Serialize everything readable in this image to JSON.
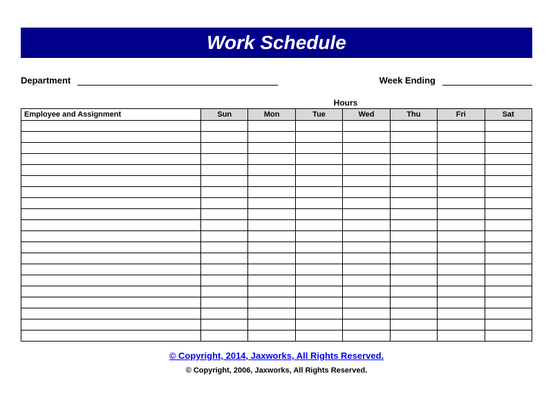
{
  "header": {
    "title": "Work Schedule"
  },
  "form": {
    "department_label": "Department",
    "week_ending_label": "Week Ending",
    "hours_label": "Hours"
  },
  "table": {
    "employee_header": "Employee and Assignment",
    "days": [
      "Sun",
      "Mon",
      "Tue",
      "Wed",
      "Thu",
      "Fri",
      "Sat"
    ],
    "row_count": 20
  },
  "footer": {
    "link_text": "© Copyright, 2014, Jaxworks, All Rights Reserved.",
    "copyright_text": "© Copyright, 2006, Jaxworks, All Rights Reserved."
  }
}
